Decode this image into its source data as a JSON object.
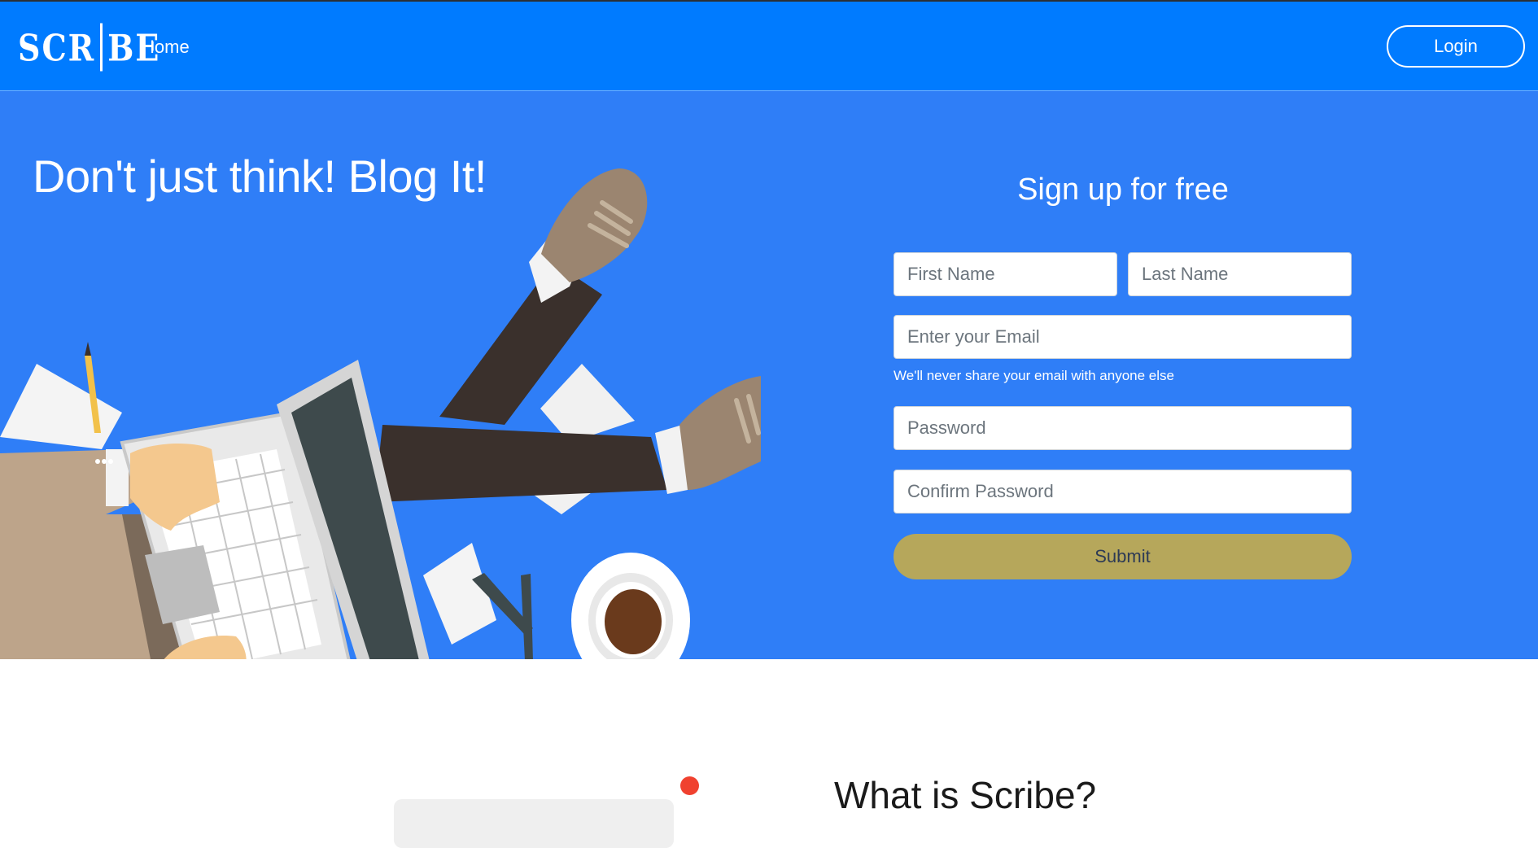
{
  "navbar": {
    "logo_text": "SCR|BE",
    "home_label": "Home",
    "login_label": "Login"
  },
  "hero": {
    "title": "Don't just think! Blog It!"
  },
  "signup": {
    "title": "Sign up for free",
    "first_name_placeholder": "First Name",
    "last_name_placeholder": "Last Name",
    "email_placeholder": "Enter your Email",
    "email_help": "We'll never share your email with anyone else",
    "password_placeholder": "Password",
    "confirm_password_placeholder": "Confirm Password",
    "submit_label": "Submit"
  },
  "about": {
    "title": "What is Scribe?"
  },
  "colors": {
    "navbar": "#007bff",
    "hero": "#2f7ef7",
    "submit": "#b6a75b",
    "dot": "#f0412f"
  }
}
